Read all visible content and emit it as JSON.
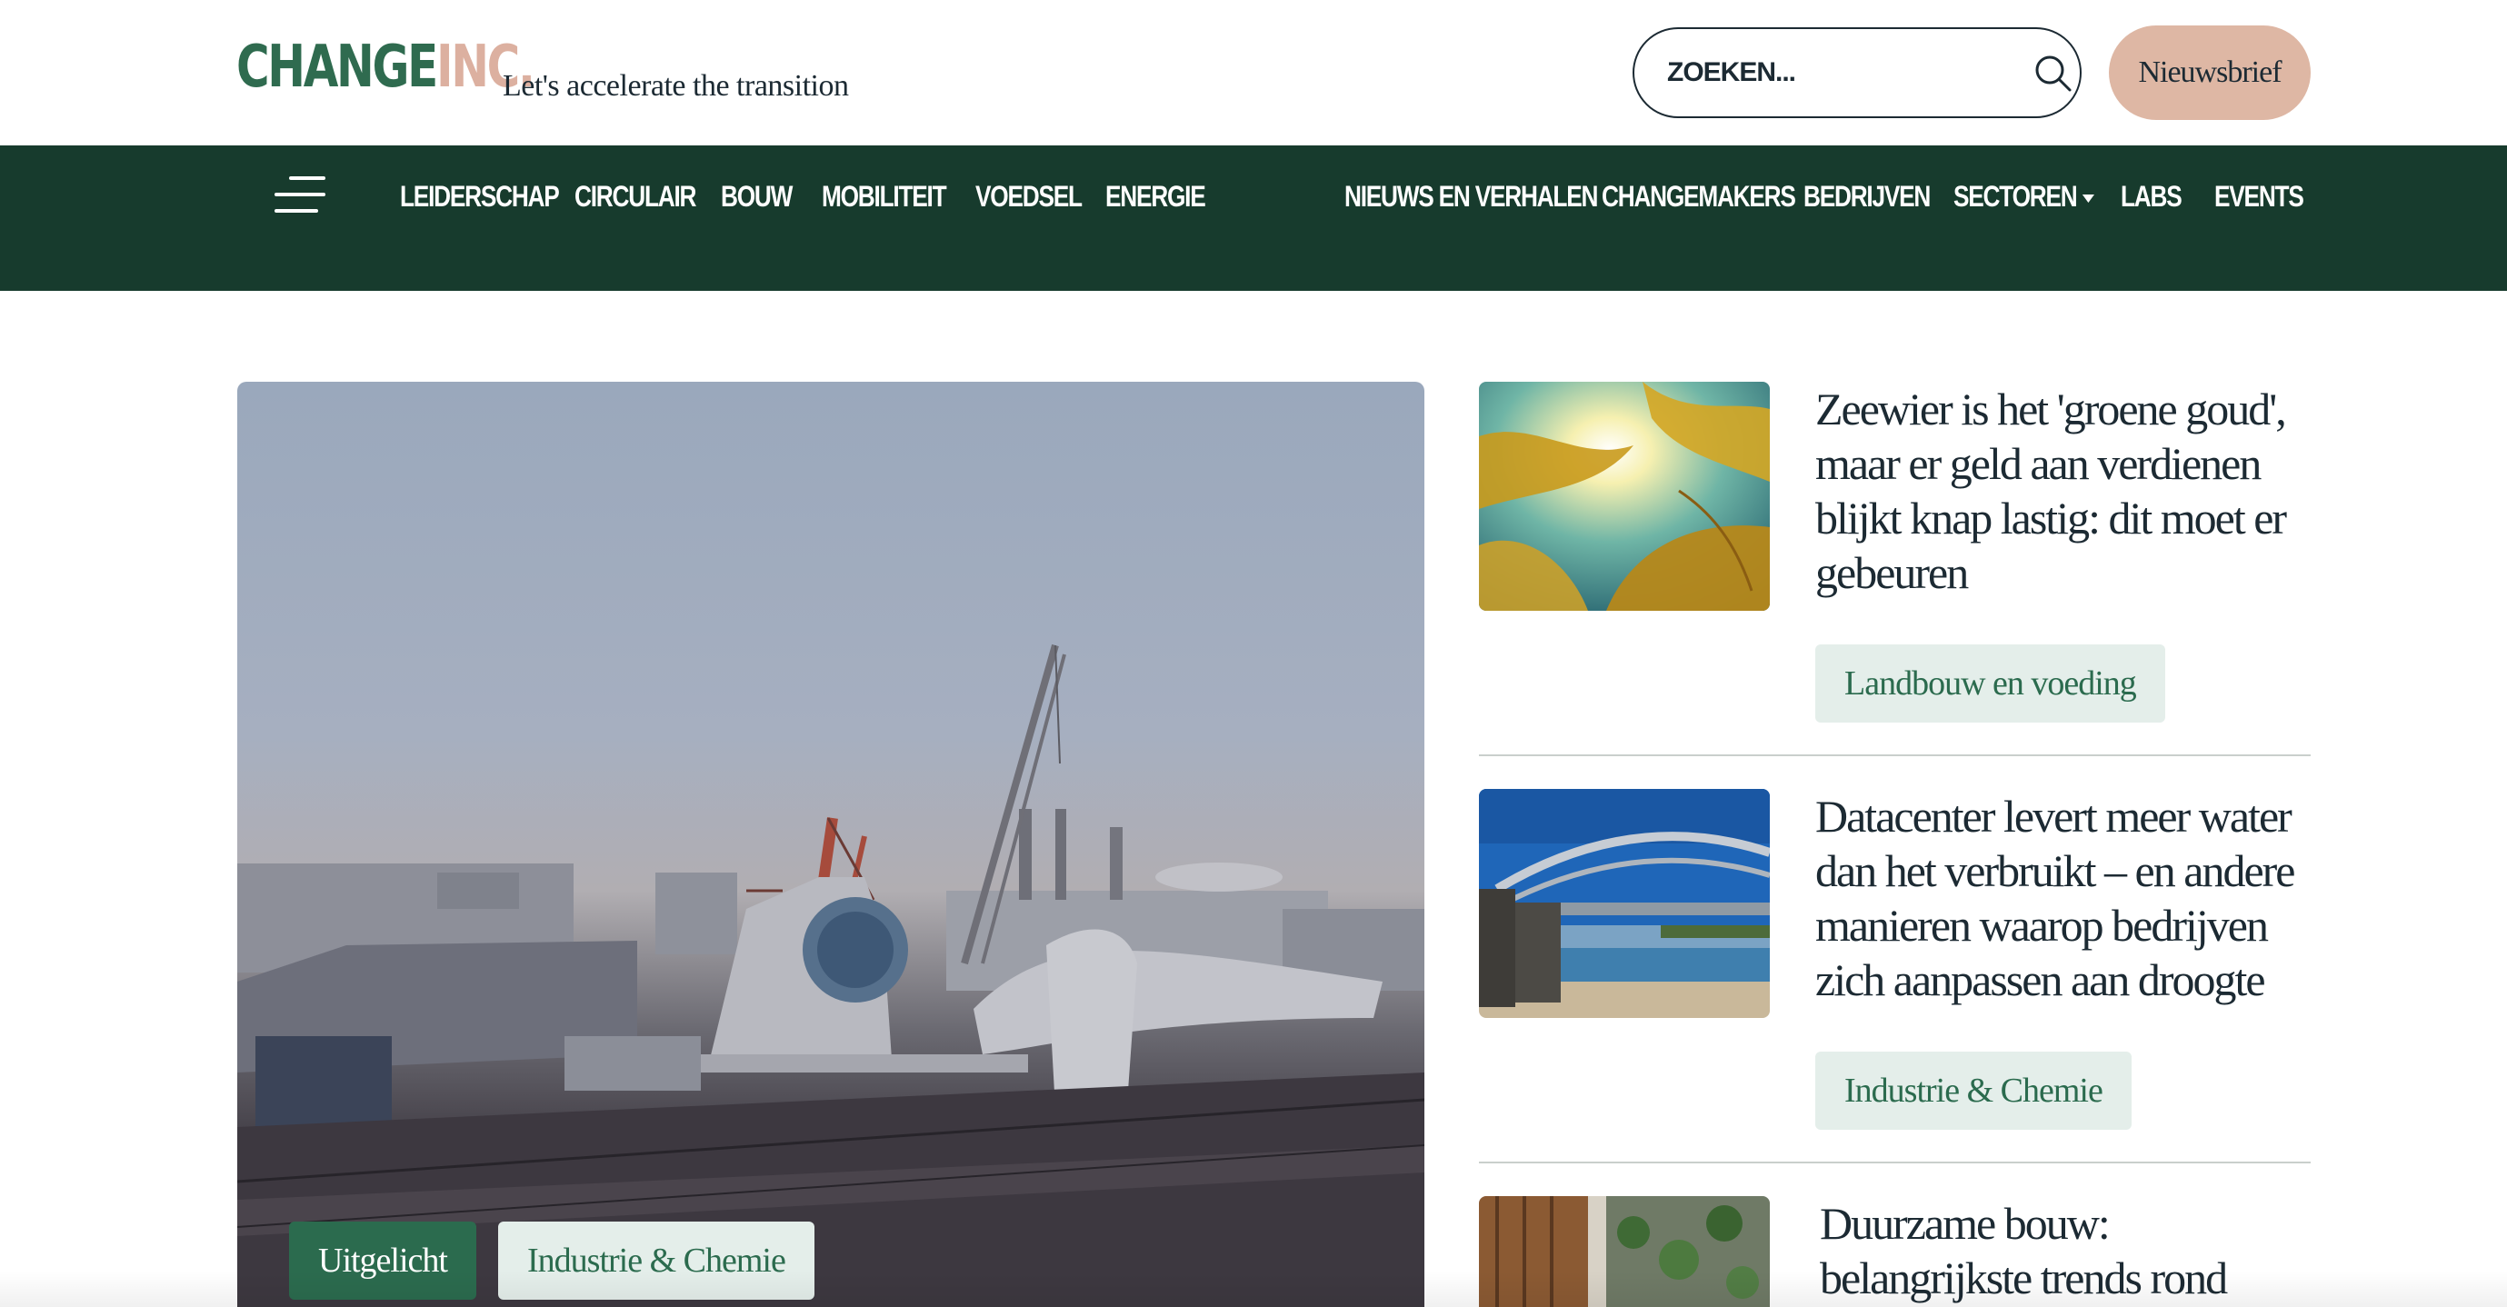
{
  "brand": {
    "logo_word1": "CHANGE",
    "logo_word2": "INC.",
    "tagline": "Let's accelerate the transition",
    "colors": {
      "primary_green": "#173b2d",
      "accent_green": "#2b6b4e",
      "peach": "#deb7a4",
      "logo_peach": "#dcb0a0"
    }
  },
  "header": {
    "search_placeholder": "ZOEKEN...",
    "search_icon": "search-icon",
    "newsletter_label": "Nieuwsbrief"
  },
  "nav": {
    "menu_icon": "hamburger-icon",
    "left_items": [
      {
        "label": "LEIDERSCHAP"
      },
      {
        "label": "CIRCULAIR"
      },
      {
        "label": "BOUW"
      },
      {
        "label": "MOBILITEIT"
      },
      {
        "label": "VOEDSEL"
      },
      {
        "label": "ENERGIE"
      }
    ],
    "right_items": [
      {
        "label": "NIEUWS EN VERHALEN"
      },
      {
        "label": "CHANGEMAKERS"
      },
      {
        "label": "BEDRIJVEN"
      },
      {
        "label": "SECTOREN",
        "dropdown": true
      },
      {
        "label": "LABS"
      },
      {
        "label": "EVENTS"
      }
    ]
  },
  "hero": {
    "image": "wind turbine components in harbour",
    "tags": [
      {
        "label": "Uitgelicht"
      },
      {
        "label": "Industrie & Chemie"
      }
    ]
  },
  "articles": [
    {
      "title": "Zeewier is het 'groene goud', maar er geld aan verdienen blijkt knap lastig: dit moet er gebeuren",
      "tag": "Landbouw en voeding",
      "image": "seaweed underwater"
    },
    {
      "title": "Datacenter levert meer water dan het verbruikt – en andere manieren waarop bedrijven zich aanpassen aan droogte",
      "tag": "Industrie & Chemie",
      "image": "bridge over river"
    },
    {
      "title": "Duurzame bouw: belangrijkste trends rond",
      "image": "green building facade"
    }
  ]
}
